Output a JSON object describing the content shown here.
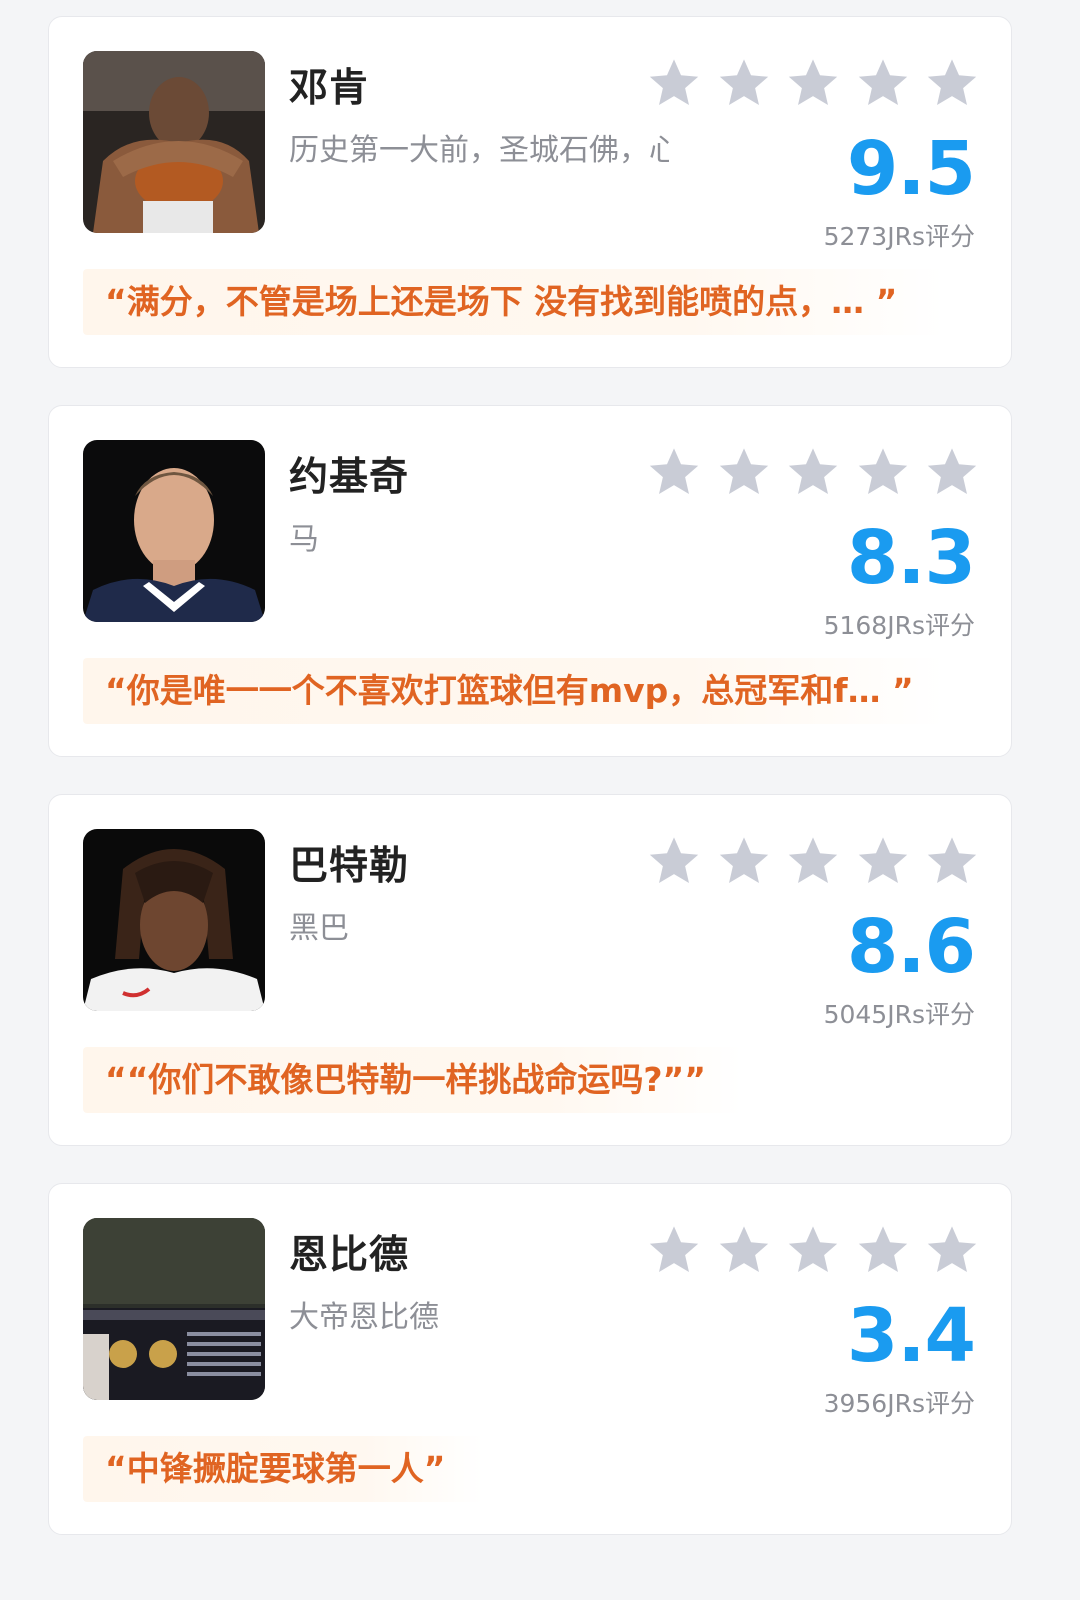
{
  "colors": {
    "score": "#1a9bf0",
    "quote": "#e06422",
    "star_inactive": "#c9ccd6",
    "quote_bg": "#fff6ec"
  },
  "star_icon": "star-icon",
  "cards": [
    {
      "name": "邓肯",
      "nickname": "历史第一大前，圣城石佛，心理…",
      "score": "9.5",
      "count": "5273JRs评分",
      "quote": "“满分，不管是场上还是场下 没有找到能喷的点，… ”",
      "stars_total": 5
    },
    {
      "name": "约基奇",
      "nickname": "马",
      "score": "8.3",
      "count": "5168JRs评分",
      "quote": "“你是唯一一个不喜欢打篮球但有mvp，总冠军和f… ”",
      "stars_total": 5
    },
    {
      "name": "巴特勒",
      "nickname": "黑巴",
      "score": "8.6",
      "count": "5045JRs评分",
      "quote": "““你们不敢像巴特勒一样挑战命运吗?””",
      "stars_total": 5
    },
    {
      "name": "恩比德",
      "nickname": "大帝恩比德",
      "score": "3.4",
      "count": "3956JRs评分",
      "quote": "“中锋撅腚要球第一人”",
      "stars_total": 5
    }
  ]
}
